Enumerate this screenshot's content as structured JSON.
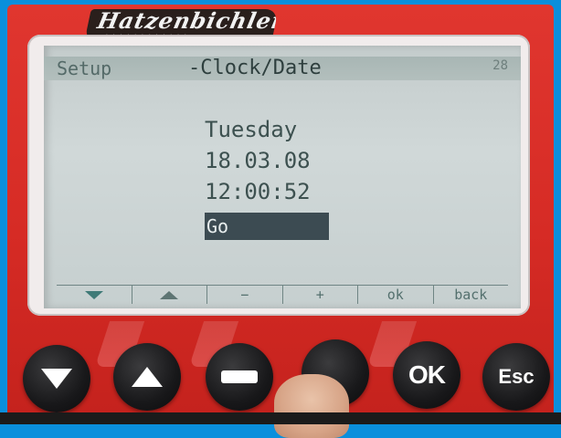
{
  "brand": {
    "logo_text": "Hatzenbichler",
    "logo_sub": "..."
  },
  "screen": {
    "menu_tab": "Setup",
    "title": "-Clock/Date",
    "page_number": "28",
    "day": "Tuesday",
    "date": "18.03.08",
    "time": "12:00:52",
    "go_label": "Go"
  },
  "softkeys": [
    {
      "icon": "down-arrow-icon",
      "label": ""
    },
    {
      "icon": "up-arrow-icon",
      "label": ""
    },
    {
      "icon": "",
      "label": "−"
    },
    {
      "icon": "",
      "label": "+"
    },
    {
      "icon": "",
      "label": "ok"
    },
    {
      "icon": "",
      "label": "back"
    }
  ],
  "hardware_keys": {
    "ok_label": "OK",
    "esc_label": "Esc"
  },
  "colors": {
    "housing": "#d62b25",
    "lcd_background": "#c8d0d0",
    "lcd_text": "#3a4d4c",
    "highlight": "#3c4b52",
    "keys": "#1a1a1a"
  }
}
